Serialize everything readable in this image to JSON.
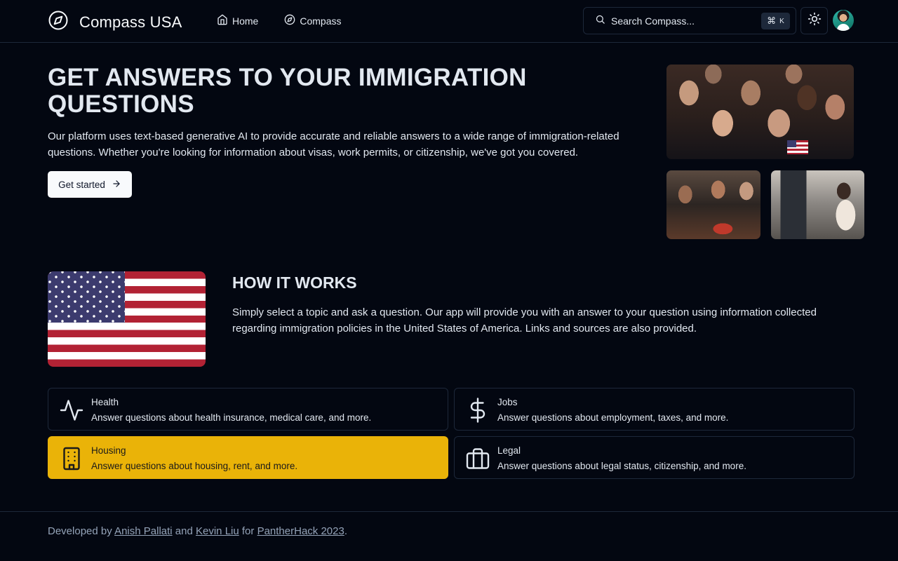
{
  "header": {
    "brand": "Compass USA",
    "nav": [
      {
        "label": "Home",
        "icon": "home-icon"
      },
      {
        "label": "Compass",
        "icon": "compass-icon"
      }
    ],
    "search": {
      "placeholder": "Search Compass...",
      "shortcut_symbol": "⌘",
      "shortcut_key": "K"
    },
    "theme_toggle_icon": "sun-icon",
    "avatar_icon": "user-avatar"
  },
  "hero": {
    "title": "GET ANSWERS TO YOUR IMMIGRATION QUESTIONS",
    "description": "Our platform uses text-based generative AI to provide accurate and reliable answers to a wide range of immigration-related questions. Whether you're looking for information about visas, work permits, or citizenship, we've got you covered.",
    "cta_label": "Get started"
  },
  "how": {
    "title": "HOW IT WORKS",
    "description": "Simply select a topic and ask a question. Our app will provide you with an answer to your question using information collected regarding immigration policies in the United States of America. Links and sources are also provided."
  },
  "topics": [
    {
      "title": "Health",
      "description": "Answer questions about health insurance, medical care, and more.",
      "icon": "activity-icon",
      "active": false
    },
    {
      "title": "Jobs",
      "description": "Answer questions about employment, taxes, and more.",
      "icon": "dollar-icon",
      "active": false
    },
    {
      "title": "Housing",
      "description": "Answer questions about housing, rent, and more.",
      "icon": "building-icon",
      "active": true
    },
    {
      "title": "Legal",
      "description": "Answer questions about legal status, citizenship, and more.",
      "icon": "briefcase-icon",
      "active": false
    }
  ],
  "footer": {
    "prefix": "Developed by",
    "author1": "Anish Pallati",
    "and": "and",
    "author2": "Kevin Liu",
    "for": "for",
    "event": "PantherHack 2023",
    "suffix": "."
  },
  "colors": {
    "background": "#030711",
    "border": "#1d283a",
    "accent_active": "#eab308",
    "text": "#e2e8f0",
    "muted": "#94a3b8"
  }
}
